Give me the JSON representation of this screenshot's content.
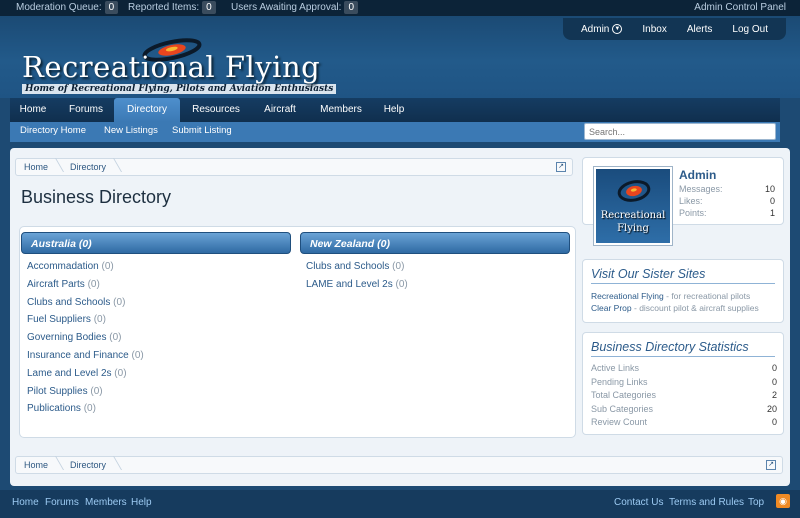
{
  "modbar": {
    "moderation_label": "Moderation Queue:",
    "moderation_count": "0",
    "reported_label": "Reported Items:",
    "reported_count": "0",
    "awaiting_label": "Users Awaiting Approval:",
    "awaiting_count": "0",
    "acp": "Admin Control Panel"
  },
  "visitor": {
    "admin": "Admin",
    "inbox": "Inbox",
    "alerts": "Alerts",
    "logout": "Log Out"
  },
  "logo": {
    "title": "Recreational Flying",
    "tagline": "Home of Recreational Flying, Pilots and Aviation Enthusiasts"
  },
  "nav": {
    "tabs": [
      "Home",
      "Forums",
      "Directory",
      "Resources",
      "Aircraft",
      "Members",
      "Help"
    ]
  },
  "subnav": {
    "items": [
      "Directory Home",
      "New Listings",
      "Submit Listing"
    ],
    "search_placeholder": "Search..."
  },
  "breadcrumb": [
    "Home",
    "Directory"
  ],
  "page_title": "Business Directory",
  "categories": {
    "left": {
      "title": "Australia (0)",
      "items": [
        {
          "name": "Accommadation",
          "count": "(0)"
        },
        {
          "name": "Aircraft Parts",
          "count": "(0)"
        },
        {
          "name": "Clubs and Schools",
          "count": "(0)"
        },
        {
          "name": "Fuel Suppliers",
          "count": "(0)"
        },
        {
          "name": "Governing Bodies",
          "count": "(0)"
        },
        {
          "name": "Insurance and Finance",
          "count": "(0)"
        },
        {
          "name": "Lame and Level 2s",
          "count": "(0)"
        },
        {
          "name": "Pilot Supplies",
          "count": "(0)"
        },
        {
          "name": "Publications",
          "count": "(0)"
        }
      ]
    },
    "right": {
      "title": "New Zealand (0)",
      "items": [
        {
          "name": "Clubs and Schools",
          "count": "(0)"
        },
        {
          "name": "LAME and Level 2s",
          "count": "(0)"
        }
      ]
    }
  },
  "sidebar": {
    "user": {
      "name": "Admin",
      "avatar_text": "Recreational Flying",
      "stats": [
        {
          "label": "Messages:",
          "value": "10"
        },
        {
          "label": "Likes:",
          "value": "0"
        },
        {
          "label": "Points:",
          "value": "1"
        }
      ]
    },
    "sister": {
      "title": "Visit Our Sister Sites",
      "sites": [
        {
          "name": "Recreational Flying",
          "desc": " - for recreational pilots"
        },
        {
          "name": "Clear Prop",
          "desc": " - discount pilot & aircraft supplies"
        }
      ]
    },
    "stats": {
      "title": "Business Directory Statistics",
      "rows": [
        {
          "label": "Active Links",
          "value": "0"
        },
        {
          "label": "Pending Links",
          "value": "0"
        },
        {
          "label": "Total Categories",
          "value": "2"
        },
        {
          "label": "Sub Categories",
          "value": "20"
        },
        {
          "label": "Review Count",
          "value": "0"
        }
      ]
    }
  },
  "footer": {
    "left": [
      "Home",
      "Forums",
      "Members",
      "Help"
    ],
    "right": [
      "Contact Us",
      "Terms and Rules",
      "Top"
    ]
  },
  "colors": {
    "accent": "#3b79b4",
    "header": "#1d4a73",
    "link": "#2c5b8a",
    "rss": "#f08a24"
  }
}
